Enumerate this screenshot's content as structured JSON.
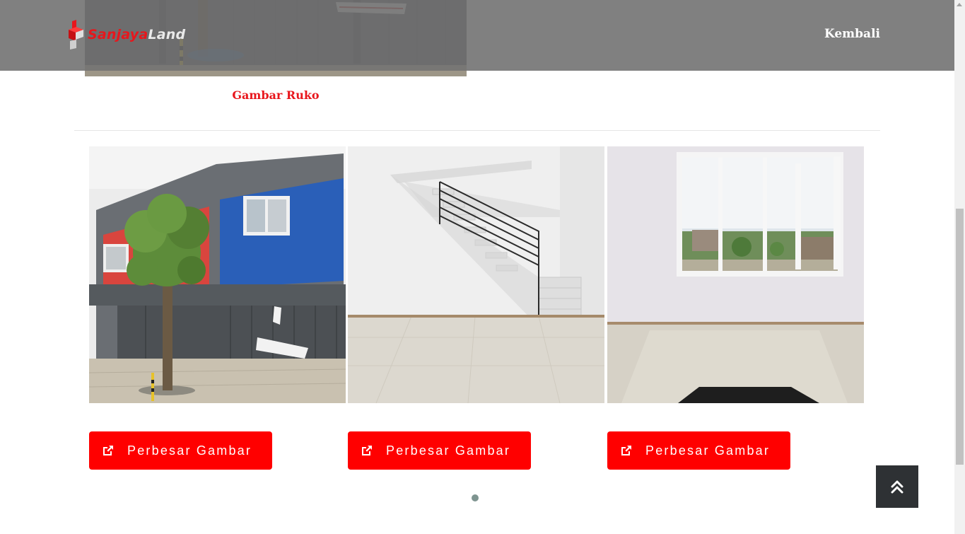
{
  "header": {
    "logo_part1": "Sanjaya",
    "logo_part2": "Land",
    "back_label": "Kembali"
  },
  "top_section": {
    "caption": "Gambar Ruko"
  },
  "gallery": {
    "items": [
      {
        "image": "ruko-exterior-photo",
        "button_label": "Perbesar Gambar",
        "button_icon": "external-link-icon"
      },
      {
        "image": "interior-stairs-photo",
        "button_label": "Perbesar Gambar",
        "button_icon": "external-link-icon"
      },
      {
        "image": "interior-window-room-photo",
        "button_label": "Perbesar Gambar",
        "button_icon": "external-link-icon"
      }
    ],
    "pager_dots": 1
  },
  "scroll_top_icon": "double-chevron-up-icon",
  "colors": {
    "accent": "#ff0000",
    "caption": "#e8161c",
    "header_bg": "#6e6e6e",
    "to_top_bg": "#2e3134"
  }
}
